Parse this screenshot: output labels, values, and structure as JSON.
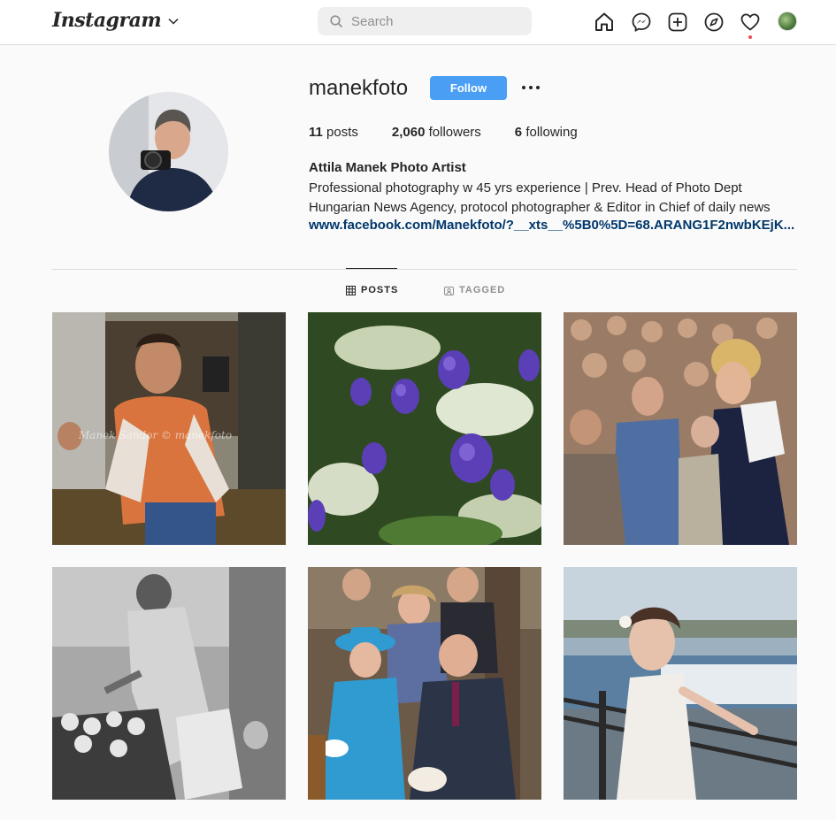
{
  "topbar": {
    "logo_text": "Instagram",
    "search_placeholder": "Search",
    "icons": [
      "home-icon",
      "messenger-icon",
      "new-post-icon",
      "explore-icon",
      "activity-heart-icon",
      "profile-avatar"
    ]
  },
  "profile": {
    "username": "manekfoto",
    "follow_label": "Follow",
    "stats": [
      {
        "value": "11",
        "label": "posts"
      },
      {
        "value": "2,060",
        "label": "followers"
      },
      {
        "value": "6",
        "label": "following"
      }
    ],
    "full_name": "Attila Manek Photo Artist",
    "bio": "Professional photography w 45 yrs experience | Prev. Head of Photo Dept Hungarian News Agency, protocol photographer & Editor in Chief of daily news",
    "link": "www.facebook.com/Manekfoto/?__xts__%5B0%5D=68.ARANG1F2nwbKEjK..."
  },
  "tabs": [
    {
      "label": "POSTS",
      "active": true
    },
    {
      "label": "TAGGED",
      "active": false
    }
  ],
  "watermark": "Manek Sandor © manekfoto",
  "colors": {
    "accent": "#4a9ff5",
    "link": "#00376b",
    "notification_dot": "#ed4956"
  }
}
